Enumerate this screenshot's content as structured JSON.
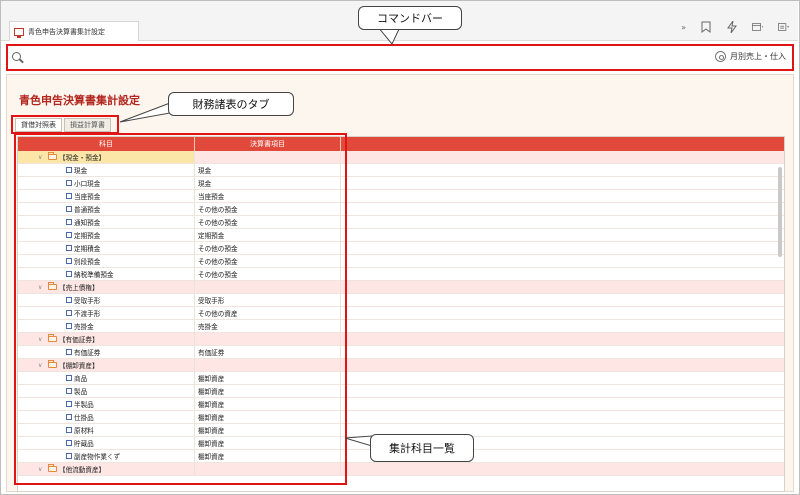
{
  "window": {
    "tab_title": "青色申告決算書集計設定"
  },
  "toolbar": {
    "overflow_glyph": "»"
  },
  "command_bar": {
    "monthly_label": "月別売上・仕入"
  },
  "page": {
    "title": "青色申告決算書集計設定",
    "tabs": [
      {
        "label": "貸借対照表",
        "active": true
      },
      {
        "label": "損益計算書",
        "active": false
      }
    ]
  },
  "grid": {
    "columns": {
      "subject": "科目",
      "item": "決算書項目"
    },
    "rows": [
      {
        "type": "group",
        "label": "【現金・預金】",
        "item": "",
        "selected": true
      },
      {
        "type": "leaf",
        "label": "現金",
        "item": "現金"
      },
      {
        "type": "leaf",
        "label": "小口現金",
        "item": "現金"
      },
      {
        "type": "leaf",
        "label": "当座預金",
        "item": "当座預金"
      },
      {
        "type": "leaf",
        "label": "普通預金",
        "item": "その他の預金"
      },
      {
        "type": "leaf",
        "label": "通知預金",
        "item": "その他の預金"
      },
      {
        "type": "leaf",
        "label": "定期預金",
        "item": "定期預金"
      },
      {
        "type": "leaf",
        "label": "定期積金",
        "item": "その他の預金"
      },
      {
        "type": "leaf",
        "label": "別段預金",
        "item": "その他の預金"
      },
      {
        "type": "leaf",
        "label": "納税準備預金",
        "item": "その他の預金"
      },
      {
        "type": "group",
        "label": "【売上債権】",
        "item": ""
      },
      {
        "type": "leaf",
        "label": "受取手形",
        "item": "受取手形"
      },
      {
        "type": "leaf",
        "label": "不渡手形",
        "item": "その他の資産"
      },
      {
        "type": "leaf",
        "label": "売掛金",
        "item": "売掛金"
      },
      {
        "type": "group",
        "label": "【有価証券】",
        "item": ""
      },
      {
        "type": "leaf",
        "label": "有価証券",
        "item": "有価証券"
      },
      {
        "type": "group",
        "label": "【棚卸資産】",
        "item": ""
      },
      {
        "type": "leaf",
        "label": "商品",
        "item": "棚卸資産"
      },
      {
        "type": "leaf",
        "label": "製品",
        "item": "棚卸資産"
      },
      {
        "type": "leaf",
        "label": "半製品",
        "item": "棚卸資産"
      },
      {
        "type": "leaf",
        "label": "仕掛品",
        "item": "棚卸資産"
      },
      {
        "type": "leaf",
        "label": "原材料",
        "item": "棚卸資産"
      },
      {
        "type": "leaf",
        "label": "貯蔵品",
        "item": "棚卸資産"
      },
      {
        "type": "leaf",
        "label": "副産物作業くず",
        "item": "棚卸資産"
      },
      {
        "type": "group",
        "label": "【他流動資産】",
        "item": ""
      }
    ]
  },
  "annotations": {
    "command_bar": "コマンドバー",
    "tabs": "財務諸表のタブ",
    "list": "集計科目一覧"
  },
  "colors": {
    "accent_red": "#e01414",
    "header_red": "#e14a3a",
    "title_red": "#b3261e"
  }
}
